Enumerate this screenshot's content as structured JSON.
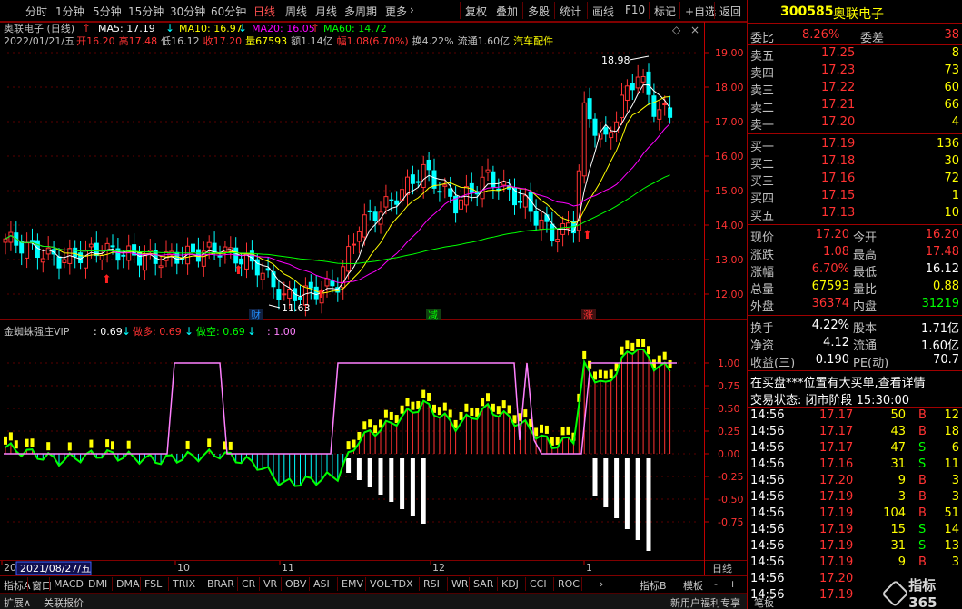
{
  "toolbar": {
    "periods": [
      "分时",
      "1分钟",
      "5分钟",
      "15分钟",
      "30分钟",
      "60分钟",
      "日线",
      "周线",
      "月线",
      "多周期",
      "更多"
    ],
    "active_period": "日线",
    "actions": [
      "复权",
      "叠加",
      "多股",
      "统计",
      "画线",
      "F10",
      "标记",
      "+自选",
      "返回"
    ]
  },
  "info": {
    "name": "奥联电子 (日线)",
    "date": "2022/01/21/五",
    "open": "开16.20",
    "high": "高17.48",
    "low": "低16.12",
    "close": "收17.20",
    "volume": "量67593",
    "amount": "额1.14亿",
    "change": "幅1.08(6.70%)",
    "turnover": "换4.22%",
    "float": "流通1.60亿",
    "sector": "汽车配件"
  },
  "ma": {
    "ma5": "MA5: 17.19",
    "ma10": "MA10: 16.97",
    "ma20": "MA20: 16.05",
    "ma60": "MA60: 14.72"
  },
  "colors": {
    "up": "#ff3232",
    "down": "#00ffff",
    "ma5": "#ffffff",
    "ma10": "#ffff00",
    "ma20": "#ff00ff",
    "ma60": "#00ff00",
    "grid": "#800000",
    "axis": "#c00000"
  },
  "price_axis": [
    "19.00",
    "18.00",
    "17.00",
    "16.00",
    "15.00",
    "14.00",
    "13.00",
    "12.00"
  ],
  "annotations": {
    "max": "18.98",
    "min": "11.63",
    "events": [
      "财",
      "减",
      "涨"
    ]
  },
  "indicator": {
    "title": "金蜘蛛强庄VIP",
    "v1": ": 0.69",
    "v2": "做多: 0.69",
    "v3": "做空: 0.69",
    "v4": ": 1.00",
    "axis": [
      "1.00",
      "0.75",
      "0.50",
      "0.25",
      "0.00",
      "-0.25",
      "-0.50",
      "-0.75"
    ]
  },
  "xaxis": {
    "labels": [
      "20",
      "10",
      "11",
      "12",
      "1"
    ],
    "cursor_date": "2021/08/27/五",
    "mode": "日线",
    "buttons": [
      "-",
      "+",
      "↓",
      "↑",
      "→"
    ]
  },
  "bottom_tabs": [
    "指标A",
    "窗口",
    "MACD",
    "DMI",
    "DMA",
    "FSL",
    "TRIX",
    "BRAR",
    "CR",
    "VR",
    "OBV",
    "ASI",
    "EMV",
    "VOL-TDX",
    "RSI",
    "WR",
    "SAR",
    "KDJ",
    "CCI",
    "ROC"
  ],
  "bottom_right_tabs": [
    "指标B",
    "模板"
  ],
  "status": {
    "left": [
      "扩展∧",
      "关联报价"
    ],
    "right": [
      "新用户福利专享",
      "笔板"
    ]
  },
  "panel": {
    "code": "300585",
    "name": "奥联电子",
    "weibi_label": "委比",
    "weibi": "8.26%",
    "weicha_label": "委差",
    "weicha": "38",
    "asks": [
      {
        "label": "卖五",
        "price": "17.25",
        "vol": "8"
      },
      {
        "label": "卖四",
        "price": "17.23",
        "vol": "73"
      },
      {
        "label": "卖三",
        "price": "17.22",
        "vol": "60"
      },
      {
        "label": "卖二",
        "price": "17.21",
        "vol": "66"
      },
      {
        "label": "卖一",
        "price": "17.20",
        "vol": "4"
      }
    ],
    "bids": [
      {
        "label": "买一",
        "price": "17.19",
        "vol": "136"
      },
      {
        "label": "买二",
        "price": "17.18",
        "vol": "30"
      },
      {
        "label": "买三",
        "price": "17.16",
        "vol": "72"
      },
      {
        "label": "买四",
        "price": "17.15",
        "vol": "1"
      },
      {
        "label": "买五",
        "price": "17.13",
        "vol": "10"
      }
    ],
    "quote": [
      {
        "l1": "现价",
        "v1": "17.20",
        "l2": "今开",
        "v2": "16.20",
        "c1": "#ff3232",
        "c2": "#ff3232"
      },
      {
        "l1": "涨跌",
        "v1": "1.08",
        "l2": "最高",
        "v2": "17.48",
        "c1": "#ff3232",
        "c2": "#ff3232"
      },
      {
        "l1": "涨幅",
        "v1": "6.70%",
        "l2": "最低",
        "v2": "16.12",
        "c1": "#ff3232",
        "c2": "#ffffff"
      },
      {
        "l1": "总量",
        "v1": "67593",
        "l2": "量比",
        "v2": "0.88",
        "c1": "#ffff00",
        "c2": "#ffff00"
      },
      {
        "l1": "外盘",
        "v1": "36374",
        "l2": "内盘",
        "v2": "31219",
        "c1": "#ff3232",
        "c2": "#00ff00"
      }
    ],
    "fin": [
      {
        "l1": "换手",
        "v1": "4.22%",
        "l2": "股本",
        "v2": "1.71亿"
      },
      {
        "l1": "净资",
        "v1": "4.12",
        "l2": "流通",
        "v2": "1.60亿"
      },
      {
        "l1": "收益(三)",
        "v1": "0.190",
        "l2": "PE(动)",
        "v2": "70.7"
      }
    ],
    "notice": "在买盘***位置有大买单,查看详情",
    "trade_state": "交易状态: 闭市阶段 15:30:00",
    "ticks": [
      {
        "t": "14:56",
        "p": "17.17",
        "v": "50",
        "d": "B",
        "n": "12"
      },
      {
        "t": "14:56",
        "p": "17.17",
        "v": "43",
        "d": "B",
        "n": "18"
      },
      {
        "t": "14:56",
        "p": "17.17",
        "v": "47",
        "d": "S",
        "n": "6"
      },
      {
        "t": "14:56",
        "p": "17.16",
        "v": "31",
        "d": "S",
        "n": "11"
      },
      {
        "t": "14:56",
        "p": "17.20",
        "v": "9",
        "d": "B",
        "n": "3"
      },
      {
        "t": "14:56",
        "p": "17.19",
        "v": "3",
        "d": "B",
        "n": "3"
      },
      {
        "t": "14:56",
        "p": "17.19",
        "v": "104",
        "d": "B",
        "n": "51"
      },
      {
        "t": "14:56",
        "p": "17.19",
        "v": "15",
        "d": "S",
        "n": "14"
      },
      {
        "t": "14:56",
        "p": "17.19",
        "v": "31",
        "d": "S",
        "n": "13"
      },
      {
        "t": "14:56",
        "p": "17.19",
        "v": "9",
        "d": "B",
        "n": "3"
      },
      {
        "t": "14:56",
        "p": "17.20",
        "v": "",
        "d": "",
        "n": ""
      },
      {
        "t": "14:56",
        "p": "17.19",
        "v": "",
        "d": "",
        "n": ""
      }
    ]
  },
  "watermark": "指标365"
}
